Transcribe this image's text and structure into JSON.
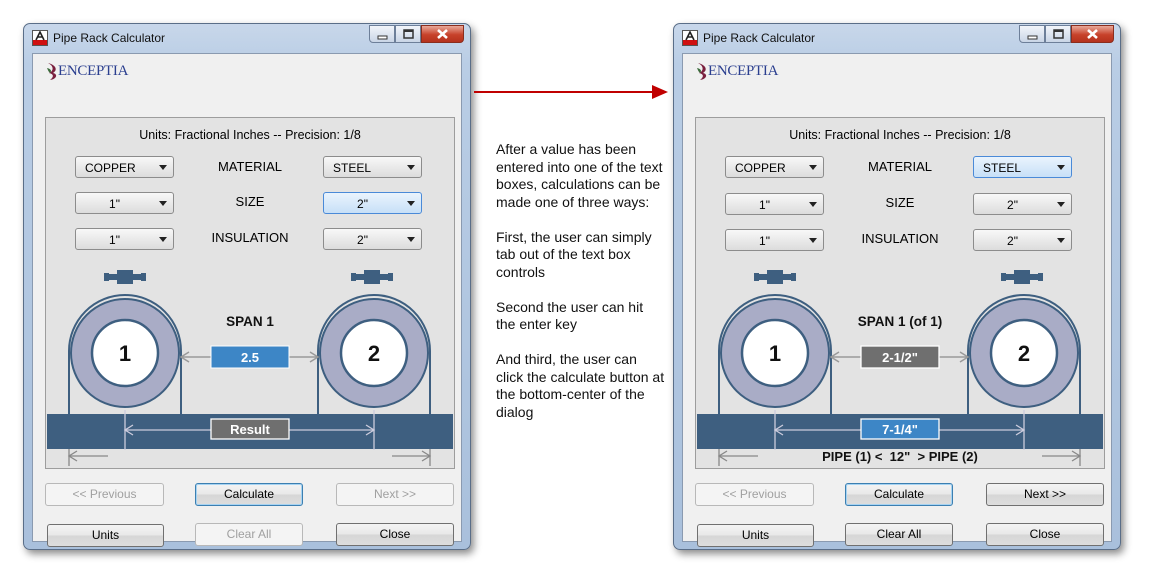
{
  "left_window": {
    "title": "Pipe Rack Calculator",
    "logo_text": "ENCEPTIA",
    "units_text": "Units: Fractional Inches -- Precision: 1/8",
    "labels": {
      "material": "MATERIAL",
      "size": "SIZE",
      "insulation": "INSULATION"
    },
    "pipe1": {
      "material": "COPPER",
      "size": "1\"",
      "insulation": "1\""
    },
    "pipe2": {
      "material": "STEEL",
      "size": "2\"",
      "insulation": "2\""
    },
    "pipe1_number": "1",
    "pipe2_number": "2",
    "span_title": "SPAN 1",
    "span_value": "2.5",
    "result_value": "Result",
    "pipe_distance_text": "",
    "buttons": {
      "previous": "<< Previous",
      "calculate": "Calculate",
      "next": "Next >>",
      "units": "Units",
      "clear_all": "Clear All",
      "close": "Close"
    }
  },
  "right_window": {
    "title": "Pipe Rack Calculator",
    "logo_text": "ENCEPTIA",
    "units_text": "Units: Fractional Inches -- Precision: 1/8",
    "labels": {
      "material": "MATERIAL",
      "size": "SIZE",
      "insulation": "INSULATION"
    },
    "pipe1": {
      "material": "COPPER",
      "size": "1\"",
      "insulation": "1\""
    },
    "pipe2": {
      "material": "STEEL",
      "size": "2\"",
      "insulation": "2\""
    },
    "pipe1_number": "1",
    "pipe2_number": "2",
    "span_title": "SPAN 1 (of 1)",
    "span_value": "2-1/2\"",
    "result_value": "7-1/4\"",
    "pipe_distance_text": "PIPE (1) <  12\"  > PIPE (2)",
    "buttons": {
      "previous": "<< Previous",
      "calculate": "Calculate",
      "next": "Next >>",
      "units": "Units",
      "clear_all": "Clear All",
      "close": "Close"
    }
  },
  "annotation": {
    "paragraphs": [
      "After a value has been entered into one of the text boxes, calculations can be made one of three ways:",
      "First, the user can simply tab out of the text box controls",
      "Second the user can hit the enter key",
      "And third, the user can click the calculate button at the bottom-center of the dialog"
    ]
  },
  "colors": {
    "arrow": "#c00000",
    "rack_beam": "#3e5f80",
    "pipe_ring": "#a9acc6",
    "focused_field": "#3d86c6",
    "readonly_field": "#6f6f6f"
  }
}
